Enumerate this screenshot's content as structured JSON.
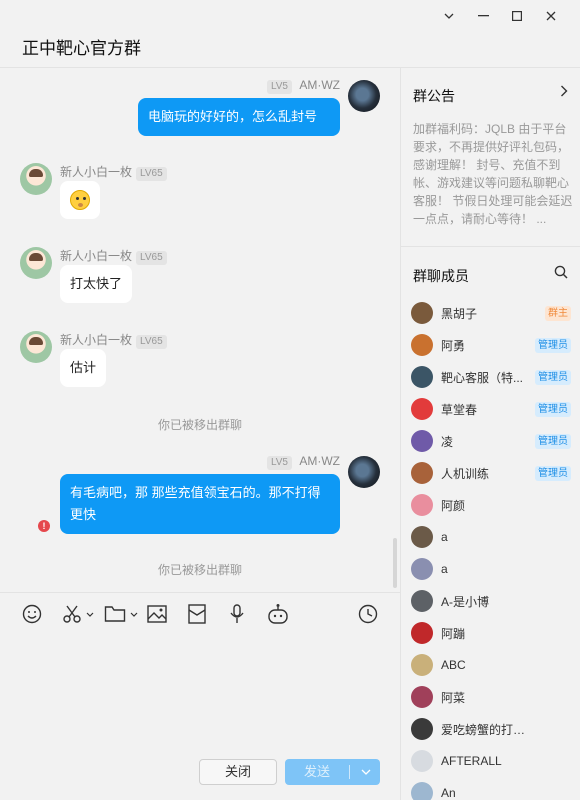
{
  "window": {
    "minimize_icon": "—",
    "maximize_icon": "☐",
    "close_icon": "✕",
    "title": "正中靶心官方群"
  },
  "messages": [
    {
      "sender": "AM·WZ",
      "level": "LV5",
      "text": "电脑玩的好好的，怎么乱封号"
    },
    {
      "sender": "新人小白一枚",
      "level": "LV65",
      "text": "😮"
    },
    {
      "sender": "新人小白一枚",
      "level": "LV65",
      "text": "打太快了"
    },
    {
      "sender": "新人小白一枚",
      "level": "LV65",
      "text": "估计"
    },
    {
      "system": "你已被移出群聊"
    },
    {
      "sender": "AM·WZ",
      "level": "LV5",
      "text": "有毛病吧，那  那些充值领宝石的。那不打得更快",
      "error": "!"
    },
    {
      "system": "你已被移出群聊"
    }
  ],
  "toolbar": {
    "tools": [
      "emoji-icon",
      "scissors-icon",
      "folder-icon",
      "image-icon",
      "redpacket-icon",
      "mic-icon",
      "robot-icon",
      "history-icon"
    ]
  },
  "actions": {
    "close_label": "关闭",
    "send_label": "发送"
  },
  "sidebar": {
    "announcement_title": "群公告",
    "announcement_text": "加群福利码：JQLB 由于平台要求，不再提供好评礼包码，感谢理解！ 封号、充值不到帐、游戏建议等问题私聊靶心客服！ 节假日处理可能会延迟一点点，请耐心等待！ ...",
    "members_title": "群聊成员",
    "members": [
      {
        "name": "黑胡子",
        "role": "群主",
        "color": "#7a5a3c"
      },
      {
        "name": "阿勇",
        "role": "管理员",
        "color": "#c9712f"
      },
      {
        "name": "靶心客服（特...",
        "role": "管理员",
        "color": "#3b5566"
      },
      {
        "name": "草堂春",
        "role": "管理员",
        "color": "#e23b3b"
      },
      {
        "name": "凌",
        "role": "管理员",
        "color": "#6f5aa8"
      },
      {
        "name": "人机训练",
        "role": "管理员",
        "color": "#a8623a"
      },
      {
        "name": "阿颜",
        "role": "",
        "color": "#e98e9e"
      },
      {
        "name": "a",
        "role": "",
        "color": "#6b5a48"
      },
      {
        "name": "a",
        "role": "",
        "color": "#8a8fb0"
      },
      {
        "name": "A-是小博",
        "role": "",
        "color": "#5d6166"
      },
      {
        "name": "阿蹦",
        "role": "",
        "color": "#c0282a"
      },
      {
        "name": "ABC",
        "role": "",
        "color": "#c9b07a"
      },
      {
        "name": "阿菜",
        "role": "",
        "color": "#a0405a"
      },
      {
        "name": "爱吃螃蟹的打工人",
        "role": "",
        "color": "#3a3a3a"
      },
      {
        "name": "AFTERALL",
        "role": "",
        "color": "#d7dbe0"
      },
      {
        "name": "An",
        "role": "",
        "color": "#9db7d0"
      }
    ]
  }
}
